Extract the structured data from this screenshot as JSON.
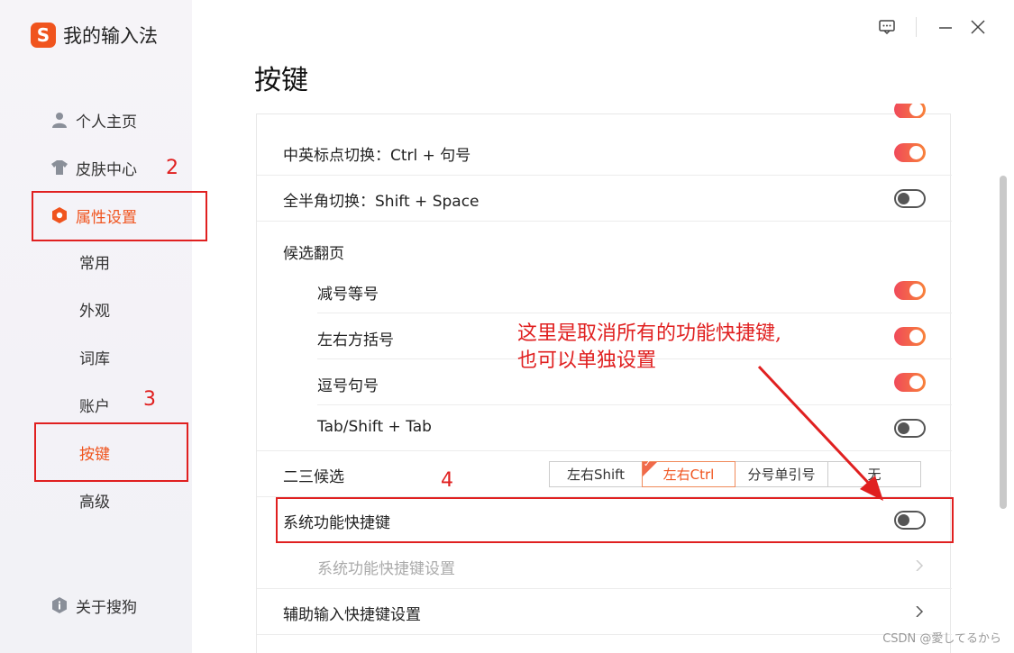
{
  "app": {
    "logo_glyph": "S",
    "title": "我的输入法"
  },
  "page": {
    "title": "按键"
  },
  "sidebar": {
    "items": [
      {
        "label": "个人主页",
        "icon": "user-icon"
      },
      {
        "label": "皮肤中心",
        "icon": "shirt-icon"
      },
      {
        "label": "属性设置",
        "icon": "settings-hex-icon",
        "active": true
      }
    ],
    "sub_items": [
      {
        "label": "常用"
      },
      {
        "label": "外观"
      },
      {
        "label": "词库"
      },
      {
        "label": "账户"
      },
      {
        "label": "按键",
        "active": true
      },
      {
        "label": "高级"
      }
    ],
    "about": {
      "label": "关于搜狗",
      "icon": "info-shield-icon"
    }
  },
  "settings": {
    "rows": [
      {
        "label": "中英标点切换：Ctrl + 句号",
        "toggle": "on"
      },
      {
        "label": "全半角切换：Shift + Space",
        "toggle": "off"
      },
      {
        "label": "候选翻页"
      },
      {
        "label": "减号等号",
        "toggle": "on"
      },
      {
        "label": "左右方括号",
        "toggle": "on"
      },
      {
        "label": "逗号句号",
        "toggle": "on"
      },
      {
        "label": "Tab/Shift + Tab",
        "toggle": "off"
      },
      {
        "label": "二三候选"
      },
      {
        "label": "系统功能快捷键",
        "toggle": "off"
      },
      {
        "label": "系统功能快捷键设置"
      },
      {
        "label": "辅助输入快捷键设置"
      }
    ],
    "second_third_options": [
      "左右Shift",
      "左右Ctrl",
      "分号单引号",
      "无"
    ],
    "second_third_selected": "左右Ctrl"
  },
  "annotations": {
    "n2": "2",
    "n3": "3",
    "n4": "4",
    "note_line1": "这里是取消所有的功能快捷键,",
    "note_line2": "也可以单独设置"
  },
  "watermark": "CSDN @愛してるから",
  "colors": {
    "accent": "#f0541e",
    "annotation_red": "#e02020",
    "toggle_on": "#f46a4a"
  }
}
